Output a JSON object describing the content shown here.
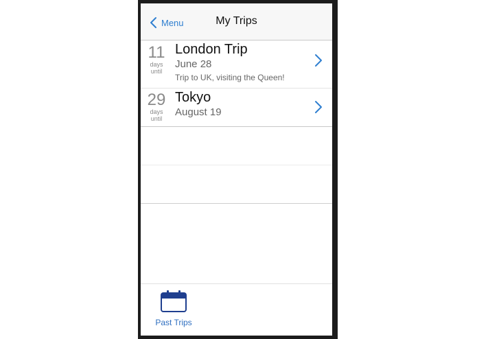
{
  "nav": {
    "back_label": "Menu",
    "title": "My Trips"
  },
  "trips": [
    {
      "days": "11",
      "days_label": "days",
      "until_label": "until",
      "name": "London Trip",
      "date": "June 28",
      "description": "Trip to UK, visiting the Queen!"
    },
    {
      "days": "29",
      "days_label": "days",
      "until_label": "until",
      "name": "Tokyo",
      "date": "August 19"
    }
  ],
  "tabbar": {
    "past_trips_label": "Past Trips",
    "icon": "calendar-icon"
  },
  "colors": {
    "accent": "#2f7fd0",
    "tab_accent": "#2f6fc0",
    "frame": "#1c1c1c"
  }
}
